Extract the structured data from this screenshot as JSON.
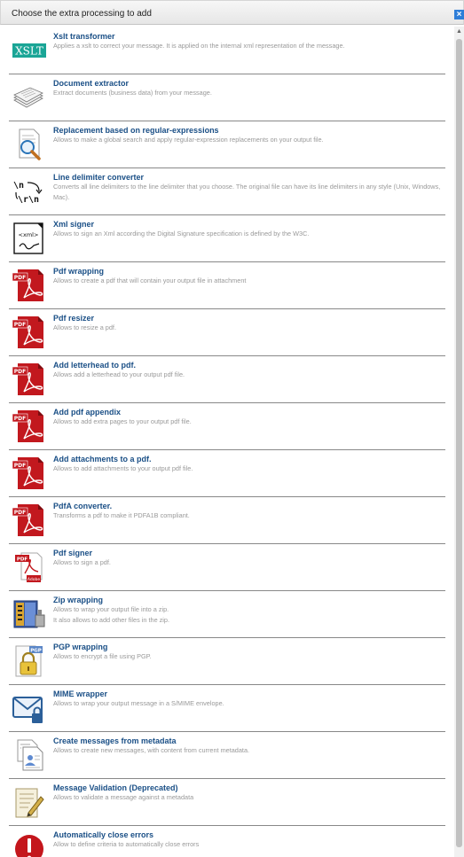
{
  "dialog": {
    "title": "Choose the extra processing to add",
    "close_label": "×"
  },
  "items": [
    {
      "name": "Xslt transformer",
      "desc": "Applies a xslt to correct your message. It is applied on the internal xml representation of the message.",
      "icon": "xslt-icon",
      "icon_text": "XSLT"
    },
    {
      "name": "Document extractor",
      "desc": "Extract documents (business data) from your message.",
      "icon": "documents-icon"
    },
    {
      "name": "Replacement based on regular-expressions",
      "desc": "Allows to make a global search and apply regular-expression replacements on your output file.",
      "icon": "search-document-icon"
    },
    {
      "name": "Line delimiter converter",
      "desc": "Converts all line delimiters to the line delimiter that you choose. The original file can have its line delimiters in any style (Unix, Windows, Mac).",
      "icon": "line-delimiter-icon",
      "icon_text_a": "\\n",
      "icon_text_b": "\\r\\n"
    },
    {
      "name": "Xml signer",
      "desc": "Allows to sign an Xml according the Digital Signature specification is defined by the W3C.",
      "icon": "xml-signer-icon",
      "icon_text": "<xml>"
    },
    {
      "name": "Pdf wrapping",
      "desc": "Allows to create a pdf that will contain your output file in attachment",
      "icon": "pdf-icon",
      "icon_text": "PDF"
    },
    {
      "name": "Pdf resizer",
      "desc": "Allows to resize a pdf.",
      "icon": "pdf-icon",
      "icon_text": "PDF"
    },
    {
      "name": "Add letterhead to pdf.",
      "desc": "Allows add a letterhead to your output pdf file.",
      "icon": "pdf-icon",
      "icon_text": "PDF"
    },
    {
      "name": "Add pdf appendix",
      "desc": "Allows to add extra pages to your output pdf file.",
      "icon": "pdf-icon",
      "icon_text": "PDF"
    },
    {
      "name": "Add attachments to a pdf.",
      "desc": "Allows to add attachments to your output pdf file.",
      "icon": "pdf-icon",
      "icon_text": "PDF"
    },
    {
      "name": "PdfA converter.",
      "desc": "Transforms a pdf to make it PDFA1B compliant.",
      "icon": "pdf-icon",
      "icon_text": "PDF"
    },
    {
      "name": "Pdf signer",
      "desc": "Allows to sign a pdf.",
      "icon": "pdf-signer-icon",
      "icon_text": "PDF",
      "icon_text_b": "Adobe"
    },
    {
      "name": "Zip wrapping",
      "desc": "Allows to wrap your output file into a zip.\nIt also allows to add other files in the zip.",
      "icon": "zip-icon"
    },
    {
      "name": "PGP wrapping",
      "desc": "Allows to encrypt a file using PGP.",
      "icon": "pgp-lock-icon",
      "icon_text": "PGP"
    },
    {
      "name": "MIME wrapper",
      "desc": "Allows to wrap your output message in a S/MIME envelope.",
      "icon": "mime-envelope-icon"
    },
    {
      "name": "Create messages from metadata",
      "desc": "Allows to create new messages, with content from current metadata.",
      "icon": "metadata-document-icon"
    },
    {
      "name": "Message Validation (Deprecated)",
      "desc": "Allows to validate a message against a metadata",
      "icon": "validation-icon"
    },
    {
      "name": "Automatically close errors",
      "desc": "Allow to define criteria to automatically close errors",
      "icon": "error-icon",
      "icon_text": "!"
    }
  ]
}
